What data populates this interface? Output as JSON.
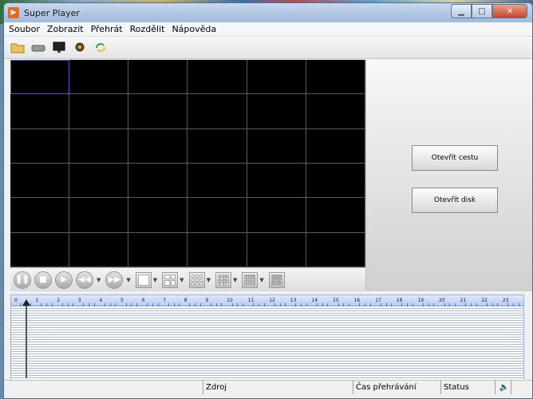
{
  "window": {
    "title": "Super Player"
  },
  "menu": {
    "items": [
      "Soubor",
      "Zobrazit",
      "Přehrát",
      "Rozdělit",
      "Nápověda"
    ]
  },
  "toolbar": {
    "icons": [
      "folder-icon",
      "hard-drive-icon",
      "monitor-icon",
      "settings-wrench-icon",
      "refresh-icon"
    ]
  },
  "panel": {
    "open_path_label": "Otevřít cestu",
    "open_disk_label": "Otevřít disk"
  },
  "timeline": {
    "hours": [
      "0",
      "1",
      "2",
      "3",
      "4",
      "5",
      "6",
      "7",
      "8",
      "9",
      "10",
      "11",
      "12",
      "13",
      "14",
      "15",
      "16",
      "17",
      "18",
      "19",
      "20",
      "21",
      "22",
      "23"
    ]
  },
  "status": {
    "source_label": "Zdroj",
    "playtime_label": "Čas přehrávání",
    "status_label": "Status"
  },
  "colors": {
    "titlebar": "#b4cbe6",
    "video_bg": "#000000",
    "grid_line": "#5a5a5a",
    "selected_cell": "#3a5fd0",
    "timeline_rule": "#a8b8e0"
  }
}
